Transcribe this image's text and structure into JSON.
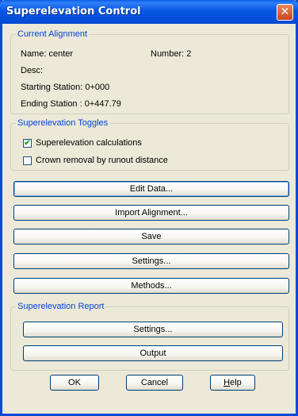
{
  "window": {
    "title": "Superelevation Control",
    "close_glyph": "✕"
  },
  "current_alignment": {
    "group_label": "Current Alignment",
    "name": "Name: center",
    "number": "Number: 2",
    "desc": "Desc:",
    "starting_station": "Starting Station: 0+000",
    "ending_station": "Ending Station  : 0+447.79"
  },
  "toggles": {
    "group_label": "Superelevation Toggles",
    "calc_label": "Superelevation calculations",
    "calc_checked": true,
    "crown_label": "Crown removal by runout distance",
    "crown_checked": false,
    "check_glyph": "✔"
  },
  "actions": {
    "edit_data": "Edit Data...",
    "import_alignment": "Import Alignment...",
    "save": "Save",
    "settings": "Settings...",
    "methods": "Methods..."
  },
  "report": {
    "group_label": "Superelevation Report",
    "settings": "Settings...",
    "output": "Output"
  },
  "dialog_buttons": {
    "ok": "OK",
    "cancel": "Cancel",
    "help_first": "H",
    "help_rest": "elp"
  }
}
